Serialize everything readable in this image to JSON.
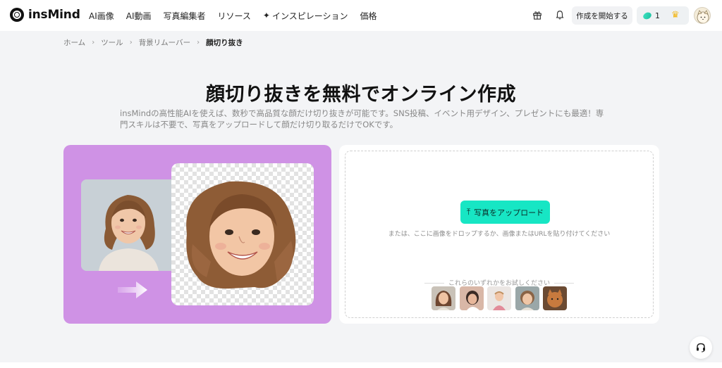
{
  "brand": {
    "name": "insMind"
  },
  "nav": {
    "links": [
      "AI画像",
      "AI動画",
      "写真編集者",
      "リソース",
      "インスピレーション",
      "価格"
    ],
    "start_button": "作成を開始する",
    "credits": "1"
  },
  "breadcrumb": [
    "ホーム",
    "ツール",
    "背景リムーバー",
    "顔切り抜き"
  ],
  "hero": {
    "title": "顔切り抜きを無料でオンライン作成",
    "subtitle": "insMindの高性能AIを使えば、数秒で高品質な顔だけ切り抜きが可能です。SNS投稿、イベント用デザイン、プレゼントにも最適！専門スキルは不要で、写真をアップロードして顔だけ切り取るだけでOKです。"
  },
  "upload": {
    "button_label": "写真をアップロード",
    "hint": "または、ここに画像をドロップするか、画像またはURLを貼り付けてください",
    "samples_label": "これらのいずれかをお試しください",
    "sample_count": 5
  },
  "icons": {
    "gift": "gift-icon",
    "bell": "bell-icon",
    "crown": "crown-icon",
    "support": "headset-icon",
    "upload": "upload-icon",
    "sparkle": "sparkle-icon"
  },
  "colors": {
    "accent": "#17e6c4",
    "demo_bg": "#cf92e5",
    "page_bg": "#f3f4f6"
  }
}
